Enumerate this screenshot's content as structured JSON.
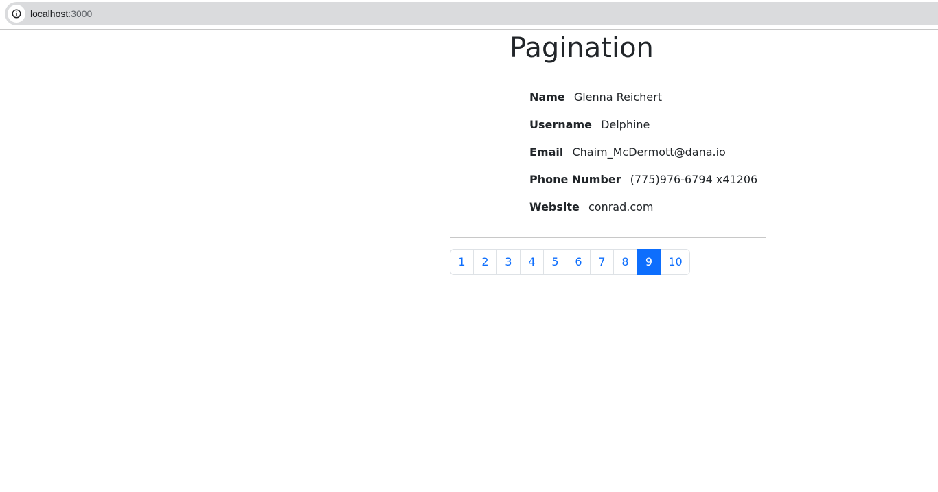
{
  "browser": {
    "url_host": "localhost",
    "url_port": ":3000",
    "info_icon": "info-icon"
  },
  "page": {
    "title": "Pagination"
  },
  "user": {
    "name_label": "Name",
    "name_value": "Glenna Reichert",
    "username_label": "Username",
    "username_value": "Delphine",
    "email_label": "Email",
    "email_value": "Chaim_McDermott@dana.io",
    "phone_label": "Phone Number",
    "phone_value": "(775)976-6794 x41206",
    "website_label": "Website",
    "website_value": "conrad.com"
  },
  "pagination": {
    "pages": [
      "1",
      "2",
      "3",
      "4",
      "5",
      "6",
      "7",
      "8",
      "9",
      "10"
    ],
    "active_page": "9",
    "accent_color": "#0d6efd"
  }
}
